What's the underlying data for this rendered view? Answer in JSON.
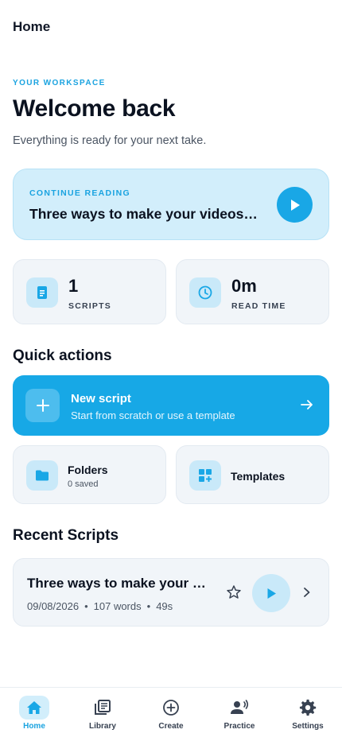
{
  "header": {
    "title": "Home"
  },
  "hero": {
    "eyebrow": "YOUR WORKSPACE",
    "title": "Welcome back",
    "subtitle": "Everything is ready for your next take."
  },
  "continue_reading": {
    "eyebrow": "CONTINUE READING",
    "title": "Three ways to make your videos f…",
    "play_icon": "play-icon"
  },
  "stats": [
    {
      "value": "1",
      "label": "SCRIPTS",
      "icon": "document-icon"
    },
    {
      "value": "0m",
      "label": "READ TIME",
      "icon": "clock-icon"
    }
  ],
  "quick_actions": {
    "title": "Quick actions",
    "new_script": {
      "title": "New script",
      "subtitle": "Start from scratch or use a template"
    },
    "folders": {
      "title": "Folders",
      "subtitle": "0 saved"
    },
    "templates": {
      "title": "Templates"
    }
  },
  "recent": {
    "title": "Recent Scripts",
    "items": [
      {
        "title": "Three ways to make your …",
        "date": "09/08/2026",
        "words": "107 words",
        "duration": "49s"
      }
    ]
  },
  "tabs": [
    {
      "label": "Home",
      "active": true
    },
    {
      "label": "Library",
      "active": false
    },
    {
      "label": "Create",
      "active": false
    },
    {
      "label": "Practice",
      "active": false
    },
    {
      "label": "Settings",
      "active": false
    }
  ],
  "colors": {
    "accent": "#19a7e6",
    "accent_light": "#d2eefb",
    "card": "#f1f5f9"
  }
}
